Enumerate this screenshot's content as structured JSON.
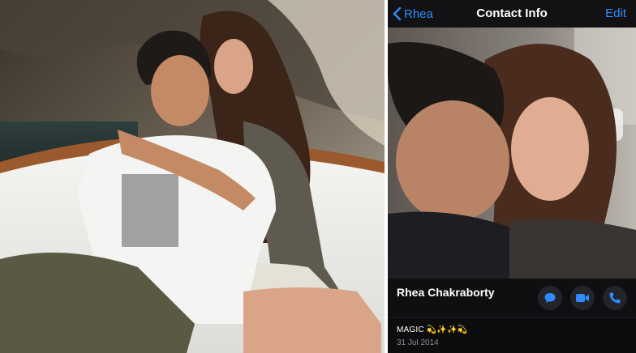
{
  "header": {
    "back_label": "Rhea",
    "title": "Contact Info",
    "edit_label": "Edit"
  },
  "contact": {
    "name": "Rhea Chakraborty",
    "about": "MAGIC 💫✨✨💫",
    "about_date": "31 Jul 2014"
  },
  "actions": [
    {
      "icon": "message-icon"
    },
    {
      "icon": "video-icon"
    },
    {
      "icon": "phone-icon"
    }
  ],
  "colors": {
    "accent": "#2e8cff",
    "background": "#0d0d0f",
    "secondary_text": "#8e8e93"
  }
}
